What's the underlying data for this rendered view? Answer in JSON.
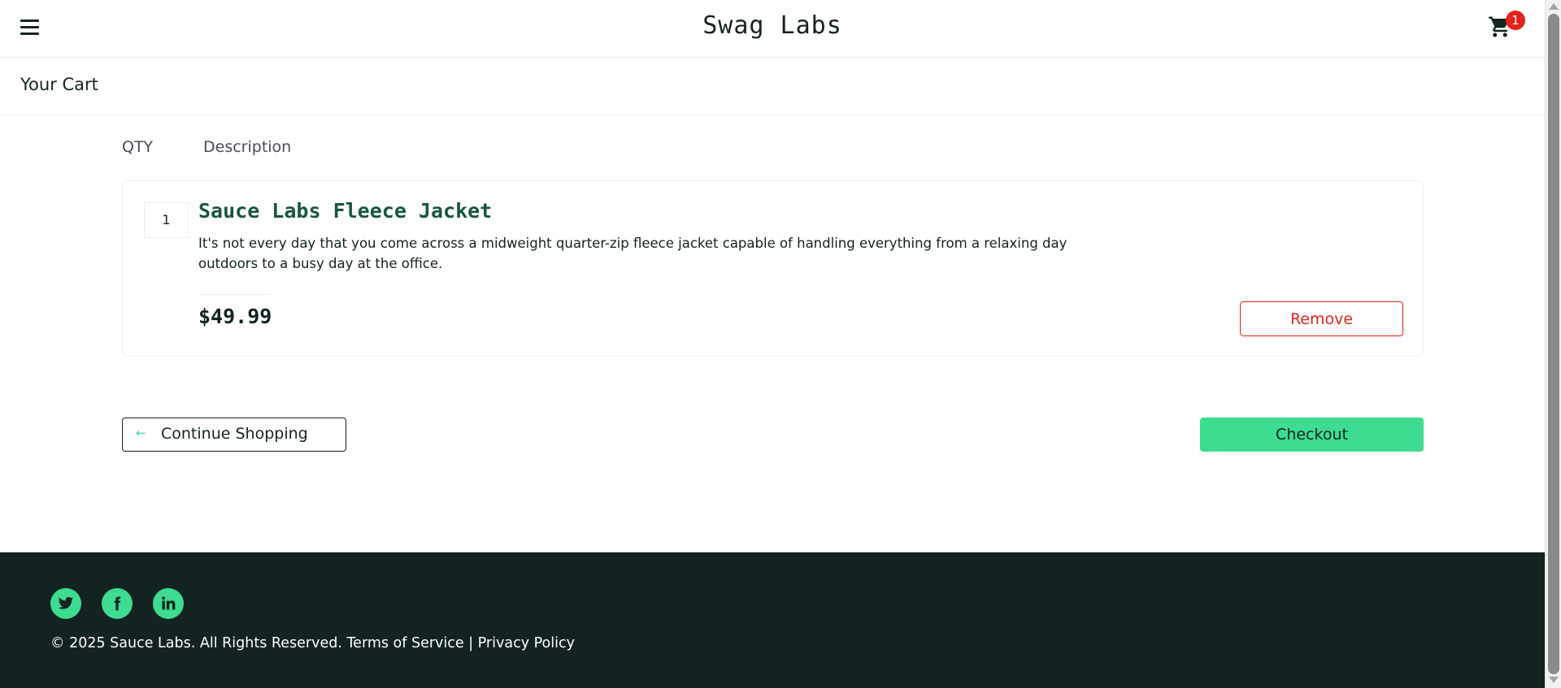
{
  "header": {
    "app_title": "Swag Labs",
    "menu_icon": "hamburger-menu-icon",
    "cart_icon": "shopping-cart-icon",
    "cart_badge_count": "1"
  },
  "secondary": {
    "page_title": "Your Cart"
  },
  "cart": {
    "qty_label": "QTY",
    "description_label": "Description",
    "items": [
      {
        "quantity": "1",
        "name": "Sauce Labs Fleece Jacket",
        "description": "It's not every day that you come across a midweight quarter-zip fleece jacket capable of handling everything from a relaxing day outdoors to a busy day at the office.",
        "price": "$49.99",
        "remove_label": "Remove"
      }
    ],
    "continue_shopping_label": "Continue Shopping",
    "checkout_label": "Checkout"
  },
  "footer": {
    "social": [
      {
        "name": "twitter",
        "icon": "twitter-icon"
      },
      {
        "name": "facebook",
        "icon": "facebook-icon"
      },
      {
        "name": "linkedin",
        "icon": "linkedin-icon"
      }
    ],
    "copy_text": "© 2025 Sauce Labs. All Rights Reserved. Terms of Service | Privacy Policy"
  },
  "colors": {
    "accent": "#3ddc91",
    "danger": "#e2231a",
    "dark": "#132322",
    "item_title": "#18583a"
  }
}
